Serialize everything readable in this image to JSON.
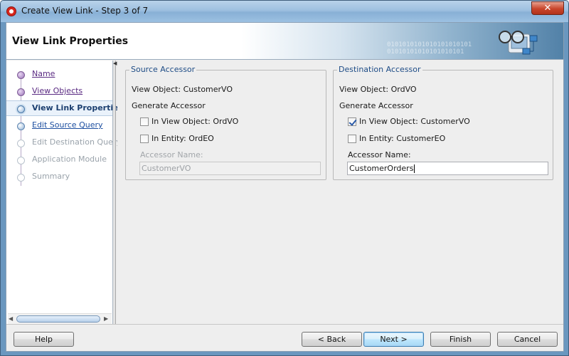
{
  "window": {
    "title": "Create View Link - Step 3 of 7",
    "close_label": "✕"
  },
  "header": {
    "title": "View Link Properties",
    "binary_text": "0101010101010101010101\n01010101010101010101"
  },
  "nav": {
    "items": [
      {
        "label": "Name",
        "state": "done"
      },
      {
        "label": "View Objects",
        "state": "done"
      },
      {
        "label": "View Link Properties",
        "state": "current"
      },
      {
        "label": "Edit Source Query",
        "state": "next"
      },
      {
        "label": "Edit Destination Query",
        "state": "future"
      },
      {
        "label": "Application Module",
        "state": "future"
      },
      {
        "label": "Summary",
        "state": "future"
      }
    ]
  },
  "source": {
    "title": "Source Accessor",
    "view_object": "View Object: CustomerVO",
    "generate": "Generate Accessor",
    "in_view_object": {
      "label": "In View Object: OrdVO",
      "checked": false
    },
    "in_entity": {
      "label": "In Entity: OrdEO",
      "checked": false
    },
    "accessor_name_label": "Accessor Name:",
    "accessor_name_value": "CustomerVO"
  },
  "destination": {
    "title": "Destination Accessor",
    "view_object": "View Object: OrdVO",
    "generate": "Generate Accessor",
    "in_view_object": {
      "label": "In View Object: CustomerVO",
      "checked": true
    },
    "in_entity": {
      "label": "In Entity: CustomerEO",
      "checked": false
    },
    "accessor_name_label": "Accessor Name:",
    "accessor_name_value": "CustomerOrders"
  },
  "buttons": {
    "help": "Help",
    "back": "< Back",
    "next": "Next >",
    "finish": "Finish",
    "cancel": "Cancel"
  }
}
